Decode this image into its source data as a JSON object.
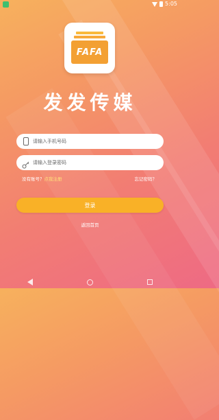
{
  "status_bar": {
    "time": "5:05"
  },
  "app": {
    "logo_text": "FAFA",
    "name": "发发传媒"
  },
  "form": {
    "phone_placeholder": "请输入手机号码",
    "password_placeholder": "请输入登录密码",
    "register_question": "没有账号？",
    "register_action": "点我注册",
    "forgot_password": "忘记密码？",
    "login_label": "登录",
    "back_home": "返回首页"
  },
  "colors": {
    "background_top": "#f7b15d",
    "background_bottom": "#ee6a84",
    "login_button": "#f9b127",
    "logo_orange": "#f3a033"
  },
  "icons": [
    "phone-icon",
    "key-icon",
    "wifi-icon",
    "battery-icon",
    "nav-back-icon",
    "nav-home-icon",
    "nav-recent-icon"
  ]
}
